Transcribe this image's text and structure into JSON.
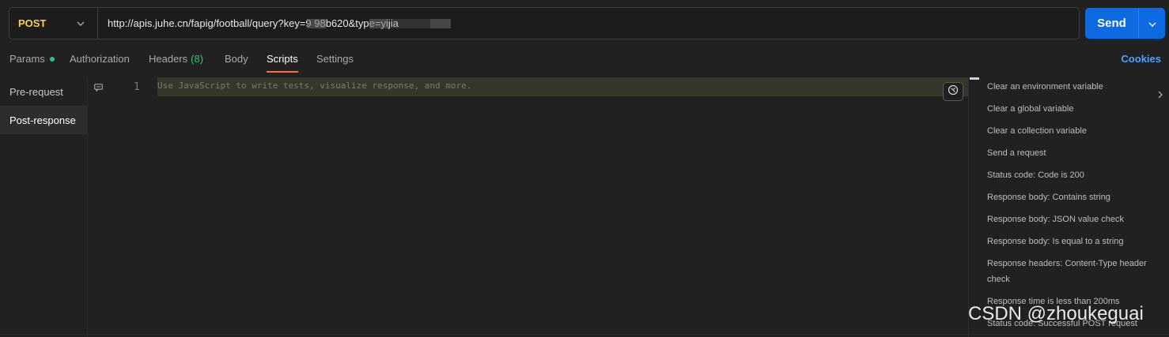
{
  "request": {
    "method": "POST",
    "url": "http://apis.juhe.cn/fapig/football/query?key=9                                         98b620&type=yijia",
    "send_label": "Send"
  },
  "tabs": [
    {
      "label": "Params",
      "has_dot": true
    },
    {
      "label": "Authorization"
    },
    {
      "label": "Headers",
      "count": "(8)"
    },
    {
      "label": "Body"
    },
    {
      "label": "Scripts",
      "active": true
    },
    {
      "label": "Settings"
    }
  ],
  "cookies_label": "Cookies",
  "script_sections": [
    {
      "label": "Pre-request"
    },
    {
      "label": "Post-response",
      "active": true
    }
  ],
  "editor": {
    "line_number": "1",
    "placeholder": "Use JavaScript to write tests, visualize response, and more."
  },
  "snippets": [
    "Clear an environment variable",
    "Clear a global variable",
    "Clear a collection variable",
    "Send a request",
    "Status code: Code is 200",
    "Response body: Contains string",
    "Response body: JSON value check",
    "Response body: Is equal to a string",
    "Response headers: Content-Type header check",
    "Response time is less than 200ms",
    "Status code: Successful POST request"
  ],
  "watermark": "CSDN @zhoukeguai",
  "colors": {
    "method": "#f5d442",
    "send": "#0e6ae0",
    "active_tab_underline": "#ff6c37",
    "params_dot": "#2ec27e",
    "cookies": "#4ea1ff"
  }
}
